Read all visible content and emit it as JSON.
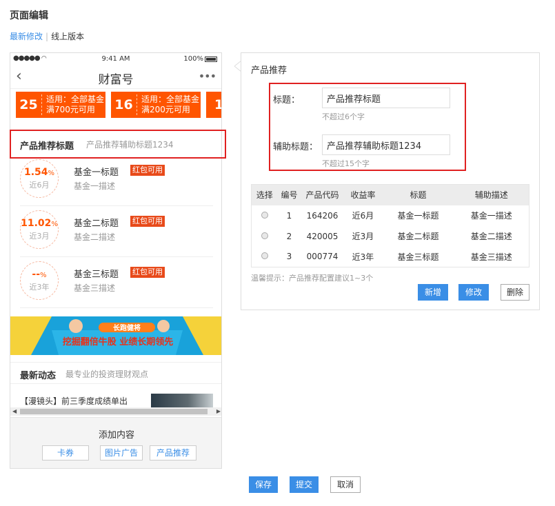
{
  "page": {
    "title": "页面编辑",
    "tab_latest": "最新修改",
    "tab_separator": "|",
    "tab_online": "线上版本"
  },
  "phone": {
    "status": {
      "signal": "●●●●● ",
      "time": "9:41 AM",
      "battery": "100%"
    },
    "nav": {
      "back": "‹",
      "title": "财富号",
      "more": "•••"
    },
    "coupons": [
      {
        "num": "25",
        "line1": "适用：全部基金",
        "line2": "满700元可用"
      },
      {
        "num": "16",
        "line1": "适用：全部基金",
        "line2": "满200元可用"
      },
      {
        "num": "1",
        "line1": "",
        "line2": ""
      }
    ],
    "recommend": {
      "title": "产品推荐标题",
      "subtitle": "产品推荐辅助标题1234"
    },
    "funds": [
      {
        "rate": "1.54",
        "unit": "%",
        "period": "近6月",
        "name": "基金一标题",
        "badge": "红包可用",
        "desc": "基金一描述"
      },
      {
        "rate": "11.02",
        "unit": "%",
        "period": "近3月",
        "name": "基金二标题",
        "badge": "红包可用",
        "desc": "基金二描述"
      },
      {
        "rate": "--",
        "unit": "%",
        "period": "近3年",
        "name": "基金三标题",
        "badge": "红包可用",
        "desc": "基金三描述"
      }
    ],
    "banner": {
      "tag": "长跑健将",
      "text": "挖掘翻倍牛股 业绩长期领先"
    },
    "news": {
      "title": "最新动态",
      "subtitle": "最专业的投资理财观点",
      "item": "【漫镜头】前三季度成绩单出"
    },
    "add_panel": {
      "title": "添加内容",
      "btn_coupon": "卡券",
      "btn_image_ad": "图片广告",
      "btn_product": "产品推荐"
    }
  },
  "editor": {
    "title": "产品推荐",
    "title_label": "标题：",
    "title_value": "产品推荐标题",
    "title_hint": "不超过6个字",
    "sub_label": "辅助标题：",
    "sub_value": "产品推荐辅助标题1234",
    "sub_hint": "不超过15个字",
    "table": {
      "headers": [
        "选择",
        "编号",
        "产品代码",
        "收益率",
        "标题",
        "辅助描述"
      ],
      "rows": [
        [
          "1",
          "164206",
          "近6月",
          "基金一标题",
          "基金一描述"
        ],
        [
          "2",
          "420005",
          "近3月",
          "基金二标题",
          "基金二描述"
        ],
        [
          "3",
          "000774",
          "近3年",
          "基金三标题",
          "基金三描述"
        ]
      ]
    },
    "tip": "温馨提示：产品推荐配置建议1~3个",
    "btn_add": "新增",
    "btn_edit": "修改",
    "btn_delete": "删除"
  },
  "footer": {
    "save": "保存",
    "submit": "提交",
    "cancel": "取消"
  },
  "colors": {
    "accent": "#3a8ee6",
    "orange": "#ff5500",
    "highlight": "#e02020"
  }
}
